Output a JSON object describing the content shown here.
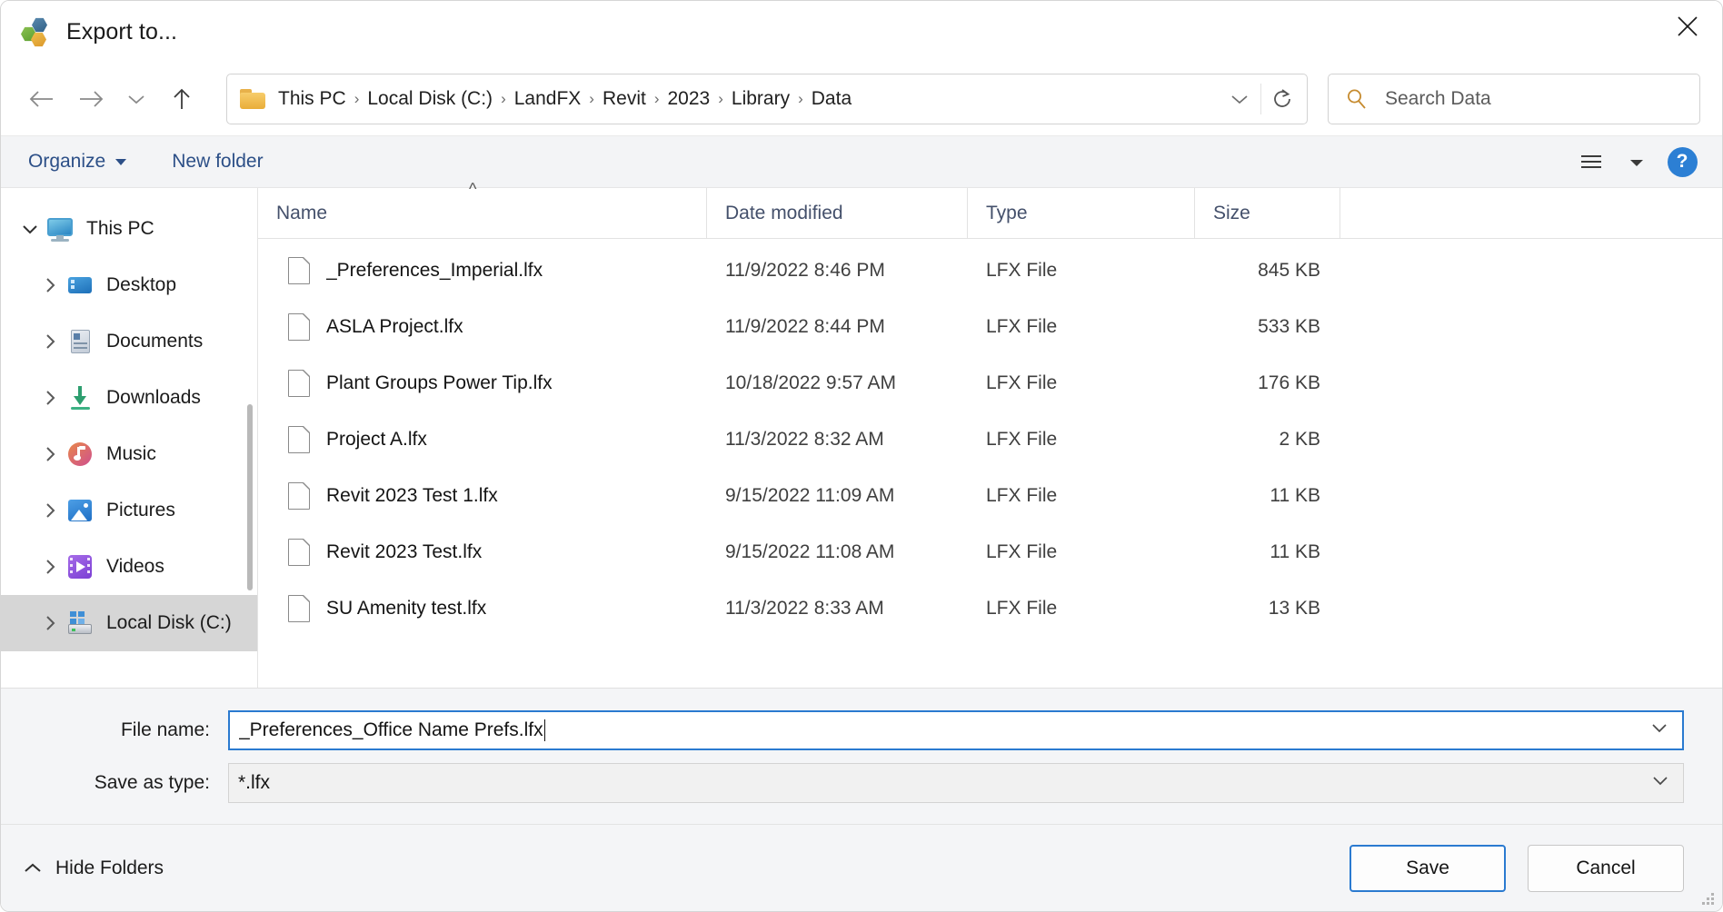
{
  "window": {
    "title": "Export to...",
    "app_icon": "hexagon-cluster-icon",
    "close_label": "Close"
  },
  "nav": {
    "back_icon": "back-arrow-icon",
    "forward_icon": "forward-arrow-icon",
    "recent_icon": "chevron-down-icon",
    "up_icon": "up-arrow-icon",
    "address_dropdown_icon": "chevron-down-icon",
    "refresh_icon": "refresh-icon",
    "breadcrumbs": [
      "This PC",
      "Local Disk (C:)",
      "LandFX",
      "Revit",
      "2023",
      "Library",
      "Data"
    ],
    "separator": "›"
  },
  "search": {
    "icon": "search-icon",
    "placeholder": "Search Data"
  },
  "commandbar": {
    "organize_label": "Organize",
    "new_folder_label": "New folder",
    "view_icon": "view-list-icon",
    "view_caret_icon": "chevron-down-icon",
    "help_icon": "help-icon",
    "help_glyph": "?"
  },
  "sidebar": {
    "items": [
      {
        "label": "This PC",
        "icon": "monitor-icon",
        "expanded": true,
        "level": 1,
        "selected": false
      },
      {
        "label": "Desktop",
        "icon": "desktop-icon",
        "expanded": false,
        "level": 2,
        "selected": false
      },
      {
        "label": "Documents",
        "icon": "documents-icon",
        "expanded": false,
        "level": 2,
        "selected": false
      },
      {
        "label": "Downloads",
        "icon": "downloads-icon",
        "expanded": false,
        "level": 2,
        "selected": false
      },
      {
        "label": "Music",
        "icon": "music-icon",
        "expanded": false,
        "level": 2,
        "selected": false
      },
      {
        "label": "Pictures",
        "icon": "pictures-icon",
        "expanded": false,
        "level": 2,
        "selected": false
      },
      {
        "label": "Videos",
        "icon": "videos-icon",
        "expanded": false,
        "level": 2,
        "selected": false
      },
      {
        "label": "Local Disk (C:)",
        "icon": "disk-icon",
        "expanded": false,
        "level": 2,
        "selected": true
      }
    ]
  },
  "filelist": {
    "columns": [
      "Name",
      "Date modified",
      "Type",
      "Size"
    ],
    "sort_column": "Name",
    "sort_direction": "ascending",
    "rows": [
      {
        "name": "_Preferences_Imperial.lfx",
        "date": "11/9/2022 8:46 PM",
        "type": "LFX File",
        "size": "845 KB"
      },
      {
        "name": "ASLA Project.lfx",
        "date": "11/9/2022 8:44 PM",
        "type": "LFX File",
        "size": "533 KB"
      },
      {
        "name": "Plant Groups Power Tip.lfx",
        "date": "10/18/2022 9:57 AM",
        "type": "LFX File",
        "size": "176 KB"
      },
      {
        "name": "Project A.lfx",
        "date": "11/3/2022 8:32 AM",
        "type": "LFX File",
        "size": "2 KB"
      },
      {
        "name": "Revit 2023 Test 1.lfx",
        "date": "9/15/2022 11:09 AM",
        "type": "LFX File",
        "size": "11 KB"
      },
      {
        "name": "Revit 2023 Test.lfx",
        "date": "9/15/2022 11:08 AM",
        "type": "LFX File",
        "size": "11 KB"
      },
      {
        "name": "SU Amenity test.lfx",
        "date": "11/3/2022 8:33 AM",
        "type": "LFX File",
        "size": "13 KB"
      }
    ]
  },
  "form": {
    "file_name_label": "File name:",
    "file_name_value": "_Preferences_Office Name Prefs.lfx",
    "save_as_type_label": "Save as type:",
    "save_as_type_value": "*.lfx",
    "dropdown_icon": "chevron-down-icon"
  },
  "footer": {
    "hide_folders_label": "Hide Folders",
    "hide_folders_icon": "chevron-up-icon",
    "save_label": "Save",
    "cancel_label": "Cancel",
    "resize_grip_icon": "resize-grip-icon"
  },
  "colors": {
    "accent": "#2a7ad0",
    "command_link": "#2c4f87",
    "column_header": "#44506b",
    "selection": "#d6d6d6",
    "toolbar_bg": "#f3f4f6"
  }
}
